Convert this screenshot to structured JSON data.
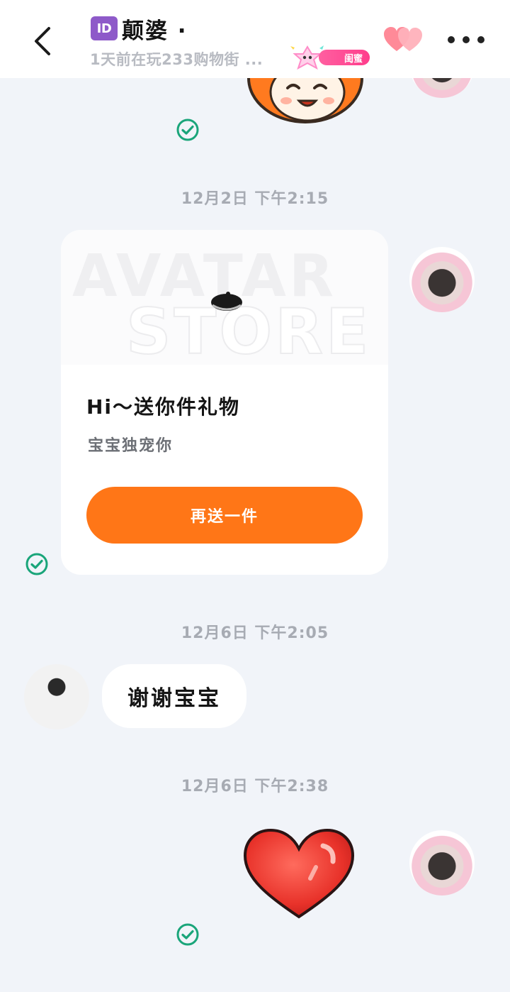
{
  "header": {
    "id_badge": "ID",
    "title": "颠婆 ·",
    "subtitle": "1天前在玩233购物街 ...",
    "status_tag": "闺蜜"
  },
  "messages": [
    {
      "type": "sticker",
      "side": "right",
      "sticker": "cartoon-girl-sticker",
      "status": "sent"
    },
    {
      "type": "timestamp",
      "text": "12月2日  下午2:15"
    },
    {
      "type": "gift",
      "side": "right",
      "banner_text_1": "AVATAR",
      "banner_text_2": "STORE",
      "title": "Hi～送你件礼物",
      "subtitle": "宝宝独宠你",
      "button": "再送一件",
      "status": "sent"
    },
    {
      "type": "timestamp",
      "text": "12月6日  下午2:05"
    },
    {
      "type": "text",
      "side": "left",
      "text": "谢谢宝宝"
    },
    {
      "type": "timestamp",
      "text": "12月6日  下午2:38"
    },
    {
      "type": "sticker",
      "side": "right",
      "sticker": "red-heart-sticker",
      "status": "sent"
    }
  ],
  "colors": {
    "accent": "#ff7617",
    "check": "#1aa57a",
    "background": "#f1f4f9"
  }
}
